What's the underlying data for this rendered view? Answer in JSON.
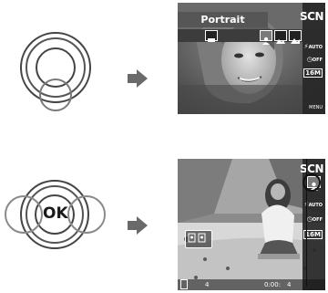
{
  "screen1": {
    "mode_title": "Portrait",
    "scn_label": "SCN",
    "sidebar": [
      "AUTO",
      "OFF",
      "16M"
    ],
    "menu_label": "MENU"
  },
  "screen2": {
    "scn_label": "SCN",
    "sidebar": [
      "AUTO",
      "OFF",
      "16M"
    ],
    "status_left": "4",
    "status_time": "0:00:",
    "status_right": "4"
  },
  "dial2": {
    "ok_label": "OK"
  },
  "icons": [
    "arrow-right-icon",
    "portrait-icon",
    "landscape-icon",
    "flash-icon",
    "self-timer-icon",
    "image-size-icon",
    "face-detect-icon"
  ]
}
